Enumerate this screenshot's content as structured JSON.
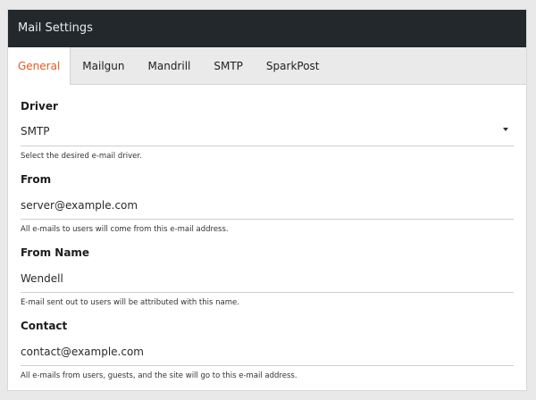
{
  "header": {
    "title": "Mail Settings"
  },
  "tabs": [
    {
      "label": "General",
      "active": true
    },
    {
      "label": "Mailgun",
      "active": false
    },
    {
      "label": "Mandrill",
      "active": false
    },
    {
      "label": "SMTP",
      "active": false
    },
    {
      "label": "SparkPost",
      "active": false
    }
  ],
  "fields": {
    "driver": {
      "label": "Driver",
      "value": "SMTP",
      "help": "Select the desired e-mail driver."
    },
    "from": {
      "label": "From",
      "value": "server@example.com",
      "help": "All e-mails to users will come from this e-mail address."
    },
    "from_name": {
      "label": "From Name",
      "value": "Wendell",
      "help": "E-mail sent out to users will be attributed with this name."
    },
    "contact": {
      "label": "Contact",
      "value": "contact@example.com",
      "help": "All e-mails from users, guests, and the site will go to this e-mail address."
    }
  },
  "colors": {
    "header_bg": "#22282c",
    "active_tab": "#e35a1c"
  },
  "icons": {
    "driver_dropdown": "caret-down-icon"
  }
}
